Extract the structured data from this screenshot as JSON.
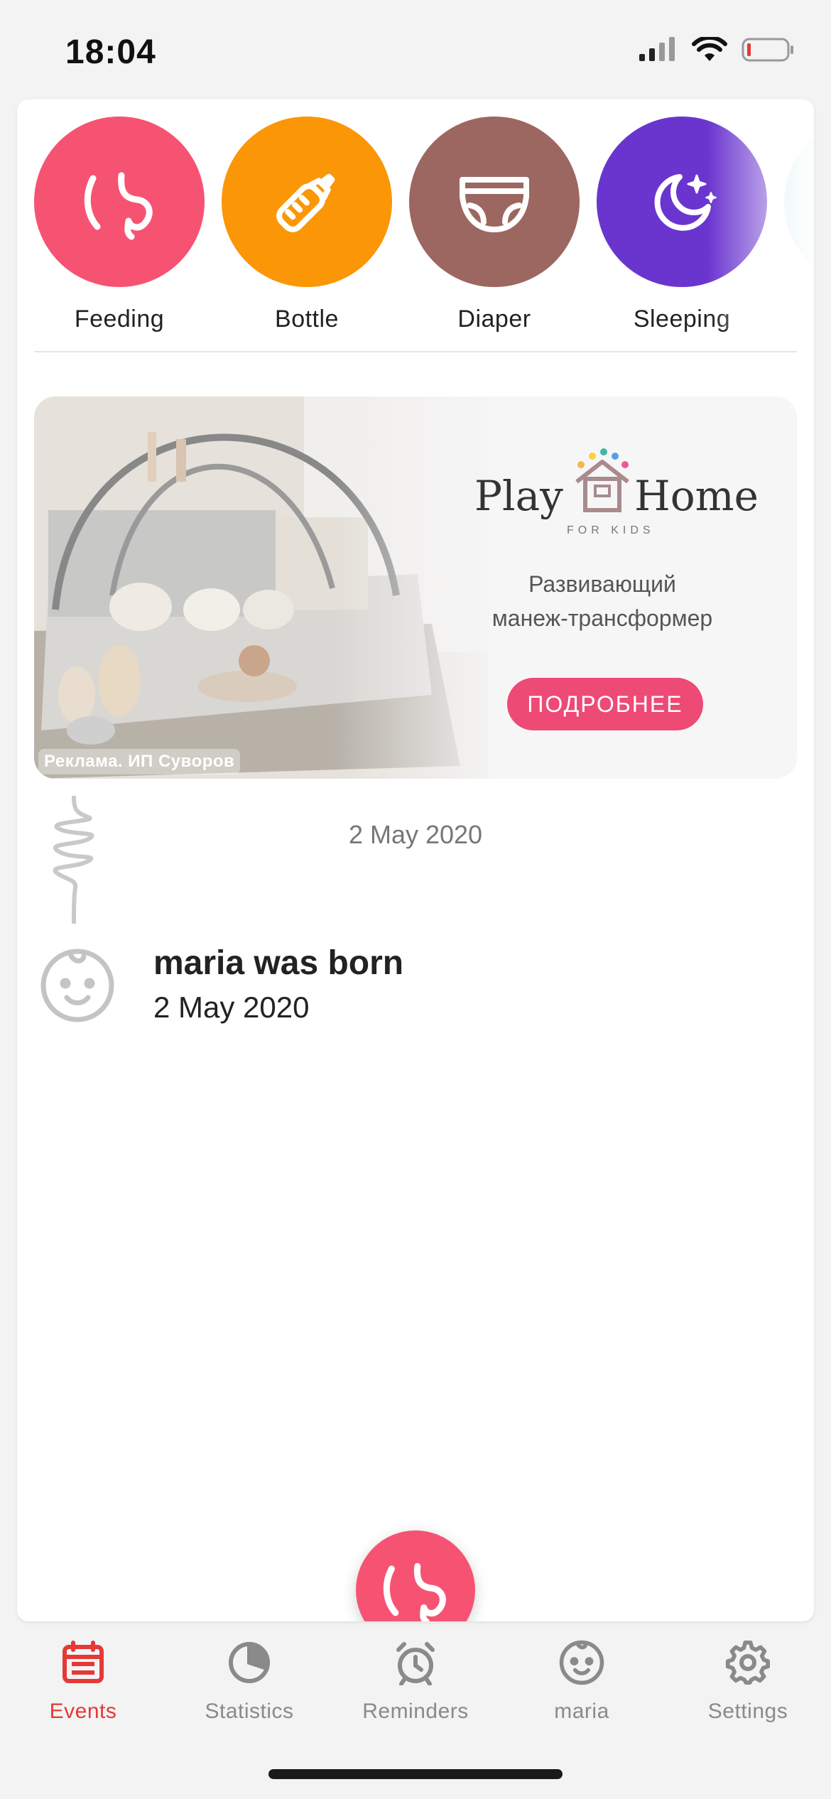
{
  "status_bar": {
    "time": "18:04"
  },
  "quick_actions": [
    {
      "label": "Feeding",
      "color": "#f65373",
      "icon": "breast-icon"
    },
    {
      "label": "Bottle",
      "color": "#fb9606",
      "icon": "bottle-icon"
    },
    {
      "label": "Diaper",
      "color": "#9c6760",
      "icon": "diaper-icon"
    },
    {
      "label": "Sleeping",
      "color": "#6a35cf",
      "icon": "moon-stars-icon"
    }
  ],
  "ad": {
    "brand_left": "Play",
    "brand_right": "Home",
    "brand_sub": "FOR KIDS",
    "text_line1": "Развивающий",
    "text_line2": "манеж-трансформер",
    "button_label": "ПОДРОБНЕЕ",
    "disclaimer": "Реклама. ИП Суворов"
  },
  "timeline": {
    "date_header": "2 May 2020",
    "events": [
      {
        "title": "maria was born",
        "date": "2 May 2020",
        "icon": "baby-face-icon"
      }
    ]
  },
  "fab": {
    "icon": "breast-icon",
    "color": "#f65373"
  },
  "tabs": [
    {
      "label": "Events",
      "icon": "calendar-icon",
      "active": true
    },
    {
      "label": "Statistics",
      "icon": "pie-chart-icon",
      "active": false
    },
    {
      "label": "Reminders",
      "icon": "alarm-clock-icon",
      "active": false
    },
    {
      "label": "maria",
      "icon": "baby-face-icon",
      "active": false
    },
    {
      "label": "Settings",
      "icon": "gear-icon",
      "active": false
    }
  ],
  "colors": {
    "accent": "#e53935",
    "tab_inactive": "#8a8a8a"
  }
}
